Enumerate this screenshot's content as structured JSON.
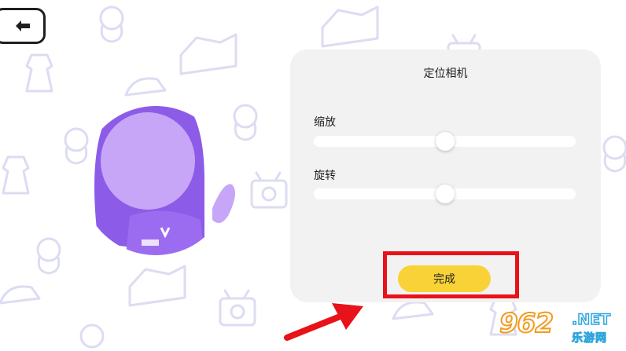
{
  "back_button": {
    "icon": "arrow-left-icon"
  },
  "panel": {
    "title": "定位相机",
    "zoom": {
      "label": "缩放",
      "value": 0.5
    },
    "rotate": {
      "label": "旋转",
      "value": 0.5
    },
    "done_label": "完成"
  },
  "watermark": {
    "main": "962",
    "net": ".NET",
    "sub": "乐游网"
  },
  "colors": {
    "panel_bg": "#f2f2f2",
    "accent_yellow": "#f8d237",
    "highlight_red": "#e8121a",
    "avatar_purple": "#9c6cf0",
    "pattern_lavender": "#dcdcf2"
  }
}
